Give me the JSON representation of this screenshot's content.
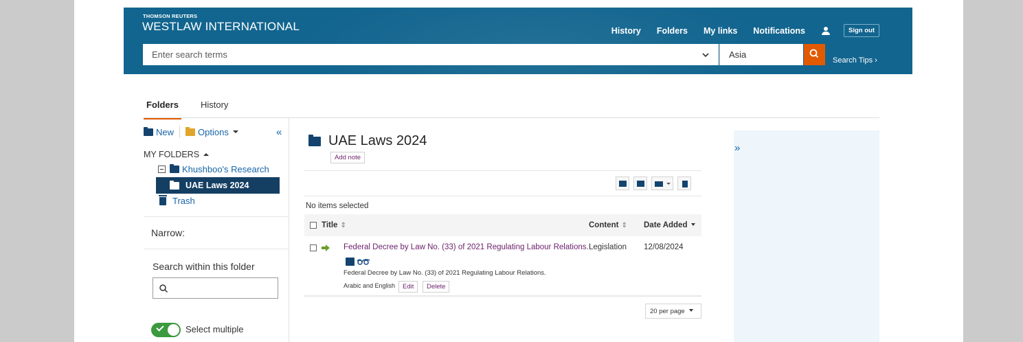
{
  "brand": {
    "top": "THOMSON REUTERS",
    "main": "WESTLAW INTERNATIONAL"
  },
  "topnav": {
    "history": "History",
    "folders": "Folders",
    "my_links": "My links",
    "notifications": "Notifications",
    "sign_out": "Sign out"
  },
  "search": {
    "placeholder": "Enter search terms",
    "jurisdiction": "Asia",
    "tips": "Search Tips ›"
  },
  "tabs": [
    {
      "label": "Folders",
      "active": true
    },
    {
      "label": "History",
      "active": false
    }
  ],
  "sidebar": {
    "new_label": "New",
    "options_label": "Options",
    "collapse_glyph": "«",
    "my_folders": "MY FOLDERS",
    "tree": {
      "parent": "Khushboo's Research",
      "selected": "UAE Laws 2024",
      "trash": "Trash"
    },
    "narrow": "Narrow:",
    "search_within": "Search within this folder",
    "select_multiple": "Select multiple"
  },
  "main": {
    "folder_title": "UAE Laws 2024",
    "add_note": "Add note",
    "no_items": "No items selected",
    "columns": {
      "title": "Title",
      "content": "Content",
      "date_added": "Date Added"
    },
    "rows": [
      {
        "title": "Federal Decree by Law No. (33) of 2021 Regulating Labour Relations.",
        "content": "Legislation",
        "date_added": "12/08/2024",
        "description": "Federal Decree by Law No. (33) of 2021 Regulating Labour Relations.",
        "language": "Arabic and English",
        "edit": "Edit",
        "delete": "Delete"
      }
    ],
    "per_page": "20 per page"
  },
  "right_panel": {
    "expand_glyph": "»"
  },
  "colors": {
    "header_blue": "#12658f",
    "accent_orange": "#e25a00",
    "selected_navy": "#143f63",
    "link_purple": "#6b1f6b",
    "toggle_green": "#3b9a3e"
  },
  "icons": [
    "new-folder-icon",
    "options-folder-icon",
    "folder-icon",
    "trash-icon",
    "search-icon",
    "user-icon",
    "chevron-down-icon",
    "arrow-right-icon",
    "note-icon",
    "glasses-icon",
    "email-icon",
    "copy-folder-icon",
    "move-folder-icon"
  ]
}
